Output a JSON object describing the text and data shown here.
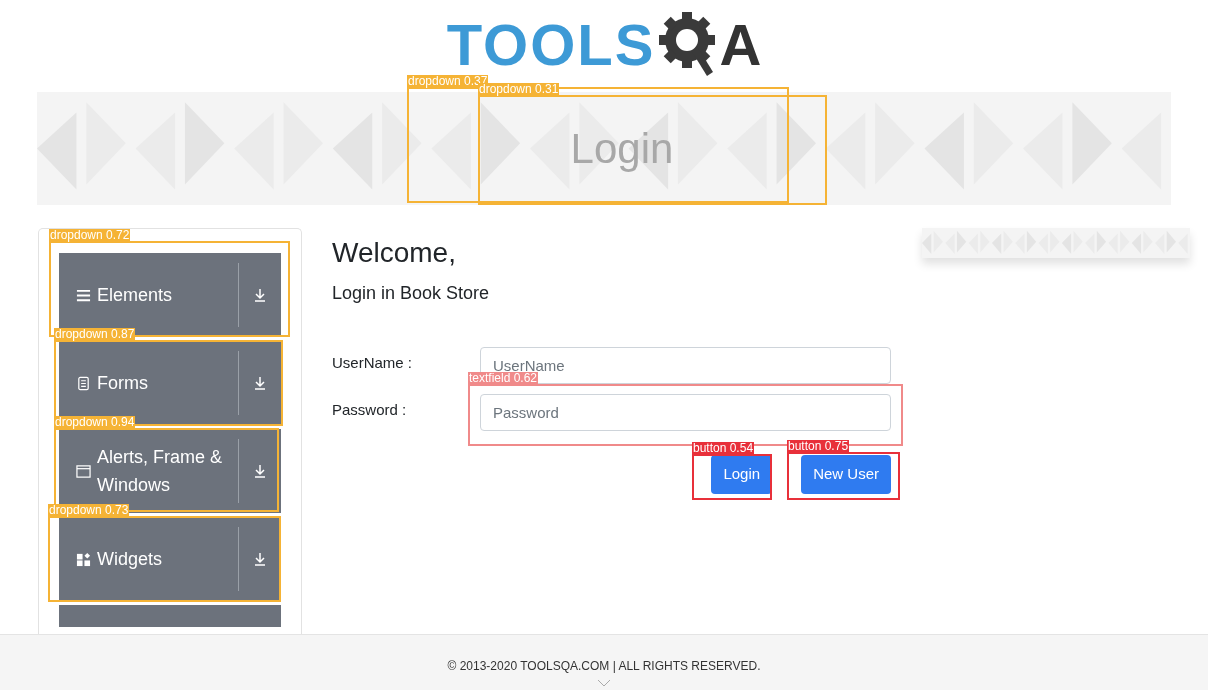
{
  "logo": {
    "text": "TOOLS",
    "tail": "A"
  },
  "banner": {
    "title": "Login"
  },
  "sidebar": {
    "items": [
      {
        "label": "Elements"
      },
      {
        "label": "Forms"
      },
      {
        "label": "Alerts, Frame & Windows"
      },
      {
        "label": "Widgets"
      }
    ]
  },
  "main": {
    "heading": "Welcome,",
    "subheading": "Login in Book Store",
    "fields": [
      {
        "label": "UserName :",
        "placeholder": "UserName"
      },
      {
        "label": "Password :",
        "placeholder": "Password"
      }
    ],
    "buttons": [
      "Login",
      "New User"
    ]
  },
  "footer": {
    "text": "© 2013-2020 TOOLSQA.COM | ALL RIGHTS RESERVED."
  },
  "detections": [
    {
      "label": "dropdown 0.37",
      "color": "#f5b335"
    },
    {
      "label": "dropdown 0.31",
      "color": "#f5b335"
    },
    {
      "label": "dropdown 0.72",
      "color": "#f5b335"
    },
    {
      "label": "dropdown 0.87",
      "color": "#f5b335"
    },
    {
      "label": "dropdown 0.94",
      "color": "#f5b335"
    },
    {
      "label": "dropdown 0.73",
      "color": "#f5b335"
    },
    {
      "label": "textfield 0.62",
      "color": "#f08a8a"
    },
    {
      "label": "button 0.54",
      "color": "#e8303a"
    },
    {
      "label": "button 0.75",
      "color": "#e8303a"
    }
  ]
}
